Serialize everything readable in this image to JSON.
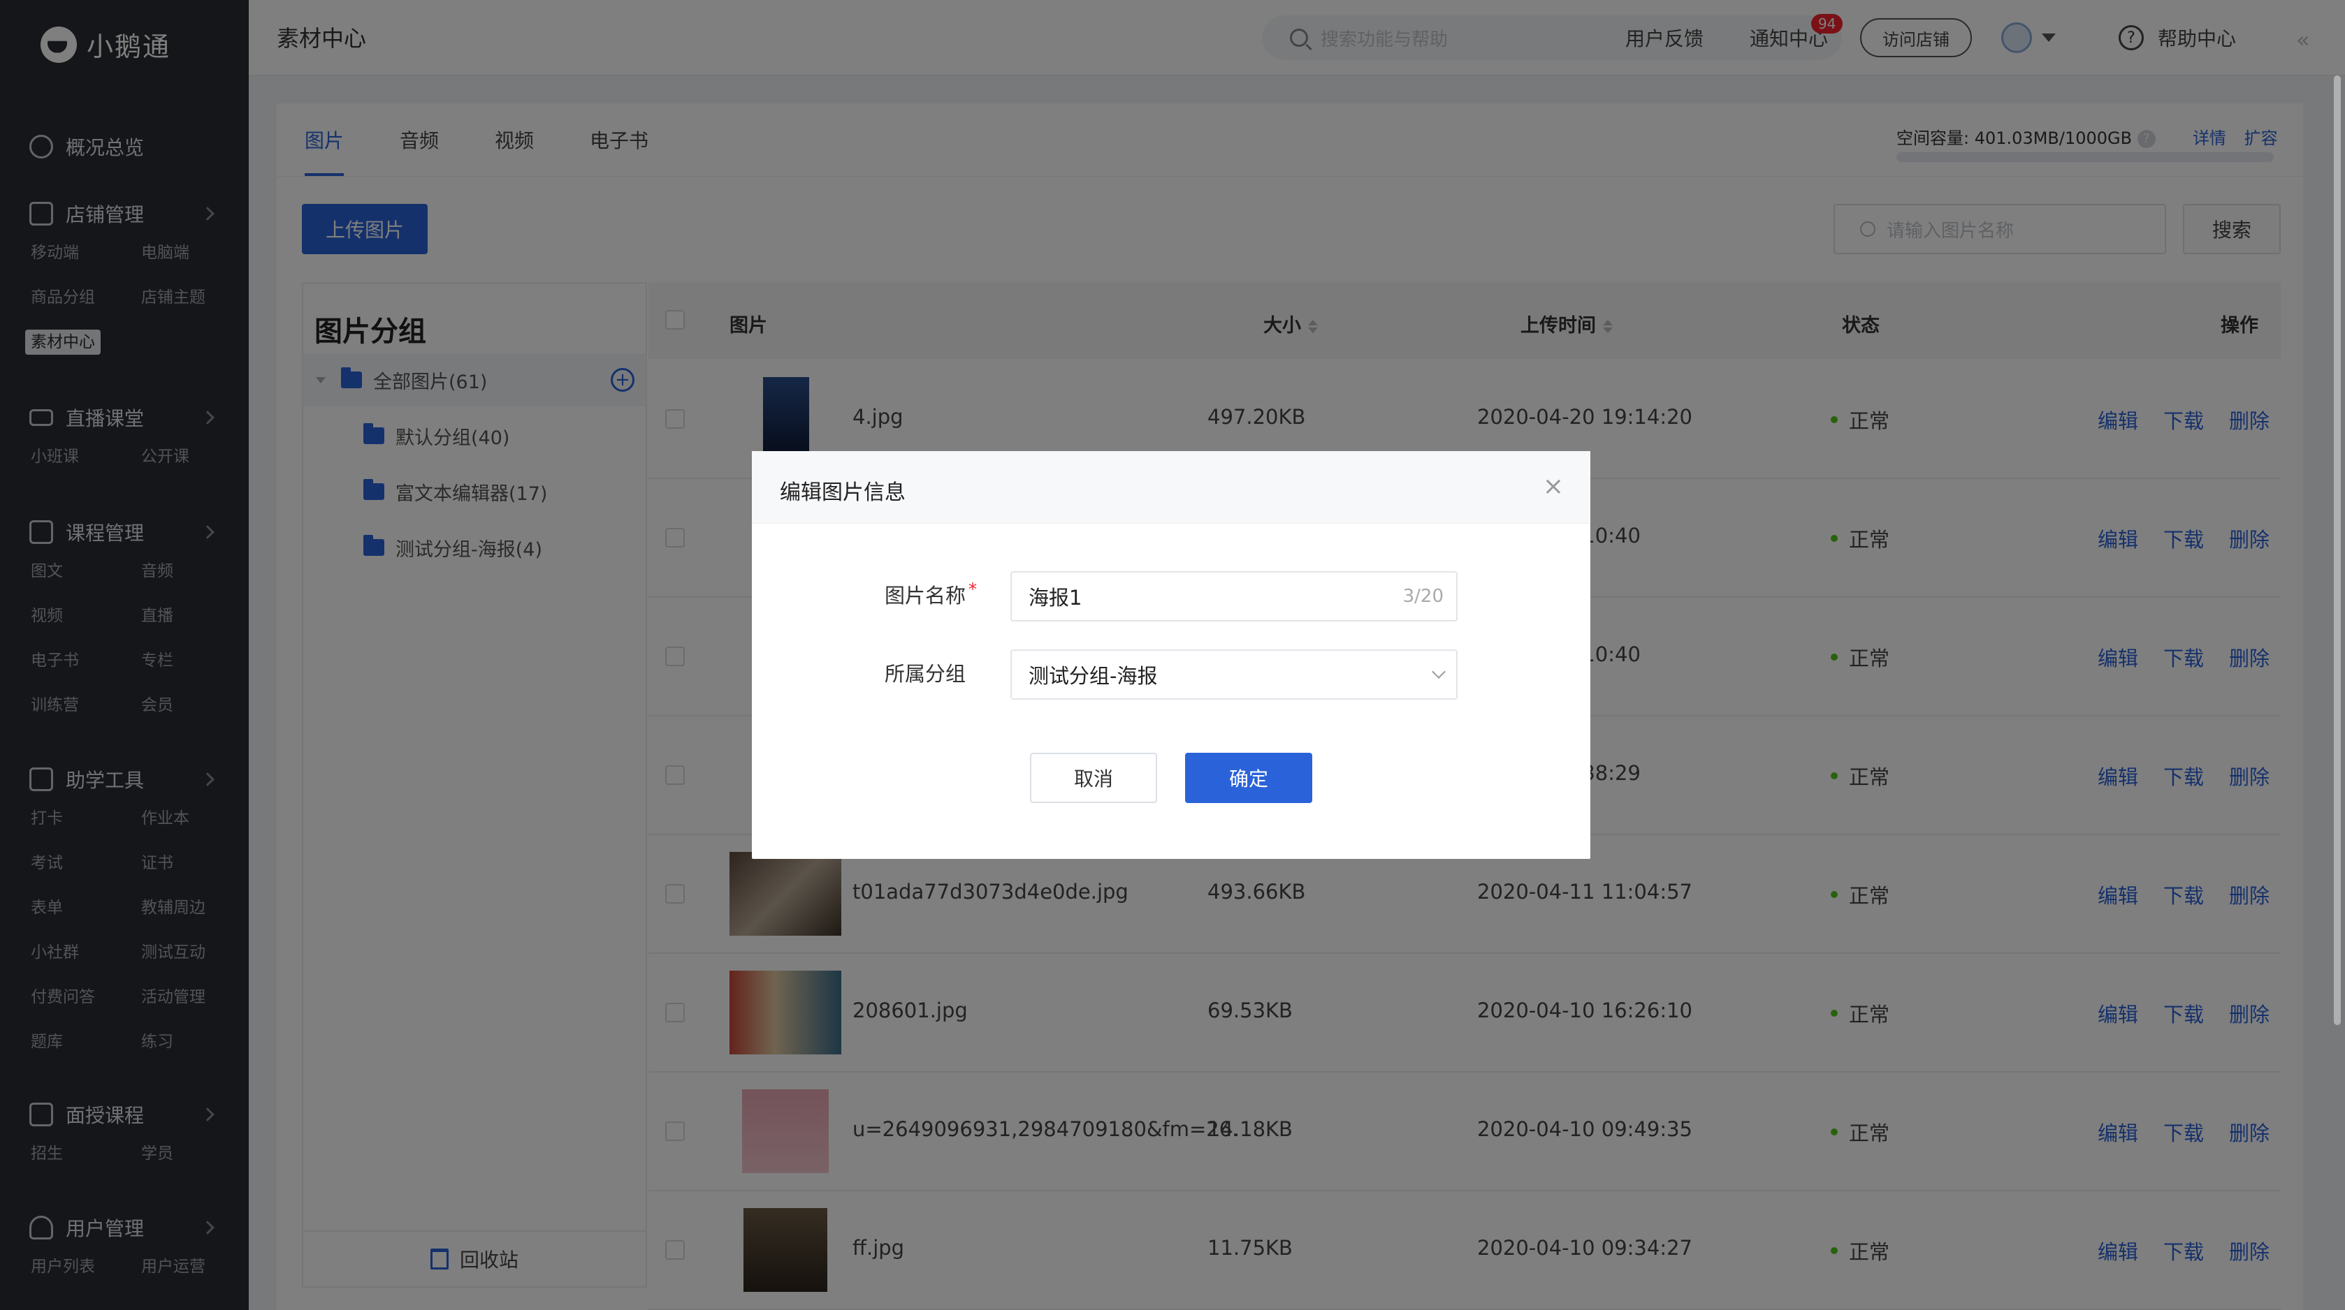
{
  "brand": {
    "name": "小鹅通"
  },
  "sidebar": {
    "groups": [
      {
        "label": "概况总览",
        "items": []
      },
      {
        "label": "店铺管理",
        "items": [
          "移动端",
          "电脑端",
          "商品分组",
          "店铺主题",
          "素材中心"
        ]
      },
      {
        "label": "直播课堂",
        "items": [
          "小班课",
          "公开课"
        ]
      },
      {
        "label": "课程管理",
        "items": [
          "图文",
          "音频",
          "视频",
          "直播",
          "电子书",
          "专栏",
          "训练营",
          "会员"
        ]
      },
      {
        "label": "助学工具",
        "items": [
          "打卡",
          "作业本",
          "考试",
          "证书",
          "表单",
          "教辅周边",
          "小社群",
          "测试互动",
          "付费问答",
          "活动管理",
          "题库",
          "练习"
        ]
      },
      {
        "label": "面授课程",
        "items": [
          "招生",
          "学员"
        ]
      },
      {
        "label": "用户管理",
        "items": [
          "用户列表",
          "用户运营"
        ]
      }
    ],
    "active_item": "素材中心"
  },
  "header": {
    "title": "素材中心",
    "search_placeholder": "搜索功能与帮助",
    "feedback": "用户反馈",
    "notifications": "通知中心",
    "notification_count": "94",
    "visit_store": "访问店铺",
    "help": "帮助中心"
  },
  "main": {
    "tabs": [
      "图片",
      "音频",
      "视频",
      "电子书"
    ],
    "active_tab": "图片",
    "capacity_label": "空间容量:",
    "capacity_value": "401.03MB/1000GB",
    "capacity_used_fraction": 0.0004,
    "capacity_detail": "详情",
    "capacity_expand": "扩容",
    "upload_button": "上传图片",
    "name_search_placeholder": "请输入图片名称",
    "search_button": "搜索"
  },
  "groups_panel": {
    "title": "图片分组",
    "groups": [
      "全部图片(61)",
      "默认分组(40)",
      "富文本编辑器(17)",
      "测试分组-海报(4)"
    ],
    "recycle": "回收站"
  },
  "table": {
    "headers": [
      "图片",
      "大小",
      "上传时间",
      "状态",
      "操作"
    ],
    "rows": [
      {
        "name": "4.jpg",
        "size": "497.20KB",
        "time": "2020-04-20 19:14:20",
        "status": "正常"
      },
      {
        "name": "",
        "size": "",
        "time": "0 17:10:40",
        "status": "正常"
      },
      {
        "name": "",
        "size": "",
        "time": "0 17:10:40",
        "status": "正常"
      },
      {
        "name": "",
        "size": "",
        "time": "0 16:38:29",
        "status": "正常"
      },
      {
        "name": "t01ada77d3073d4e0de.jpg",
        "size": "493.66KB",
        "time": "2020-04-11 11:04:57",
        "status": "正常"
      },
      {
        "name": "208601.jpg",
        "size": "69.53KB",
        "time": "2020-04-10 16:26:10",
        "status": "正常"
      },
      {
        "name": "u=2649096931,2984709180&fm=26.",
        "size": "14.18KB",
        "time": "2020-04-10 09:49:35",
        "status": "正常"
      },
      {
        "name": "ff.jpg",
        "size": "11.75KB",
        "time": "2020-04-10 09:34:27",
        "status": "正常"
      }
    ],
    "ops": [
      "编辑",
      "下载",
      "删除"
    ]
  },
  "modal": {
    "title": "编辑图片信息",
    "name_label": "图片名称",
    "name_required_mark": "*",
    "name_value": "海报1",
    "name_counter": "3/20",
    "group_label": "所属分组",
    "group_value": "测试分组-海报",
    "cancel": "取消",
    "confirm": "确定"
  },
  "colors": {
    "accent": "#2a63d9",
    "sidebar_bg": "#2b2d32",
    "status_ok": "#52c41a",
    "badge": "#f5222d"
  }
}
